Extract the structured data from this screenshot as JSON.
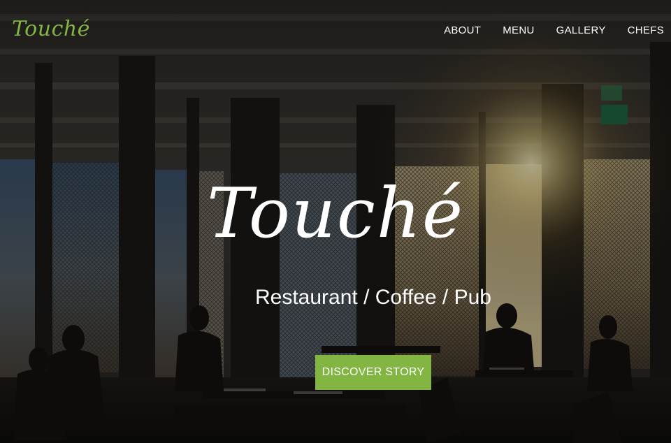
{
  "brand": {
    "logo_text": "Touché"
  },
  "nav": {
    "items": [
      {
        "label": "ABOUT"
      },
      {
        "label": "MENU"
      },
      {
        "label": "GALLERY"
      },
      {
        "label": "CHEFS"
      }
    ]
  },
  "hero": {
    "title": "Touché",
    "subtitle": "Restaurant / Coffee / Pub",
    "cta_label": "DISCOVER STORY"
  },
  "colors": {
    "accent": "#82b541",
    "text": "#ffffff"
  }
}
